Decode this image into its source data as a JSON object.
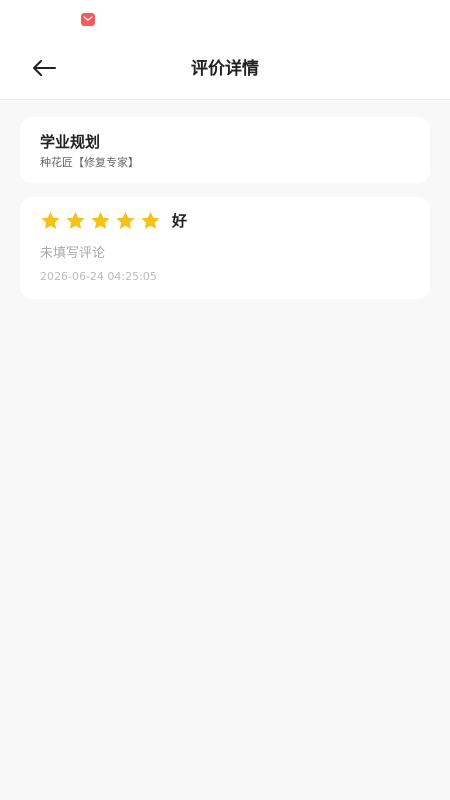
{
  "status_bar": {
    "notification_icon": "mail-icon",
    "notification_color": "#f15b5b"
  },
  "header": {
    "back_icon": "arrow-left-icon",
    "title": "评价详情"
  },
  "service": {
    "title": "学业规划",
    "subtitle": "种花匠【修复专家】"
  },
  "review": {
    "rating": 5,
    "max_rating": 5,
    "star_color": "#f5c219",
    "rating_text": "好",
    "comment": "未填写评论",
    "timestamp": "2026-06-24 04:25:05"
  }
}
